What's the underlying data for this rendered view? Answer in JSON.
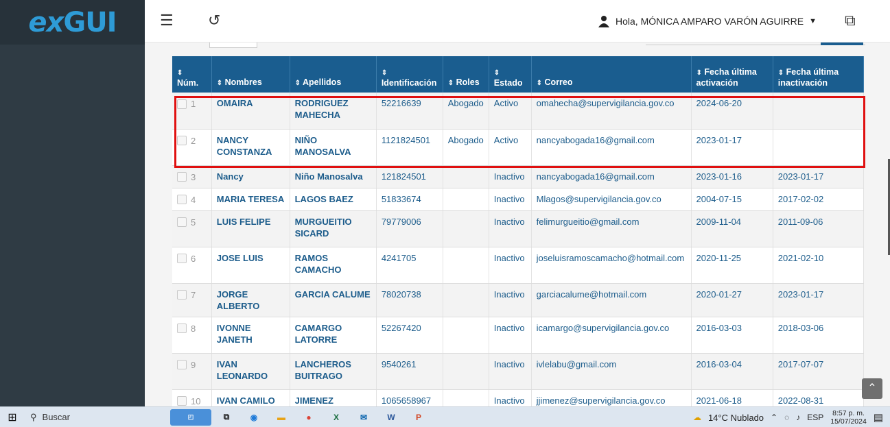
{
  "logo": {
    "prefix": "ex",
    "suffix": "GUI"
  },
  "topbar": {
    "menu_icon": "☰",
    "history_icon": "↺",
    "user_greeting": "Hola, MÓNICA AMPARO VARÓN AGUIRRE",
    "external_icon": "⧉"
  },
  "table": {
    "headers": [
      "Núm.",
      "Nombres",
      "Apellidos",
      "Identificación",
      "Roles",
      "Estado",
      "Correo",
      "Fecha última activación",
      "Fecha última inactivación"
    ],
    "rows": [
      {
        "num": "1",
        "nombres": "OMAIRA",
        "apellidos": "RODRIGUEZ MAHECHA",
        "id": "52216639",
        "roles": "Abogado",
        "estado": "Activo",
        "correo": "omahecha@supervigilancia.gov.co",
        "activacion": "2024-06-20",
        "inactivacion": ""
      },
      {
        "num": "2",
        "nombres": "NANCY CONSTANZA",
        "apellidos": "NIÑO MANOSALVA",
        "id": "1121824501",
        "roles": "Abogado",
        "estado": "Activo",
        "correo": "nancyabogada16@gmail.com",
        "activacion": "2023-01-17",
        "inactivacion": ""
      },
      {
        "num": "3",
        "nombres": "Nancy",
        "apellidos": "Niño Manosalva",
        "id": "121824501",
        "roles": "",
        "estado": "Inactivo",
        "correo": "nancyabogada16@gmail.com",
        "activacion": "2023-01-16",
        "inactivacion": "2023-01-17"
      },
      {
        "num": "4",
        "nombres": "MARIA TERESA",
        "apellidos": "LAGOS BAEZ",
        "id": "51833674",
        "roles": "",
        "estado": "Inactivo",
        "correo": "Mlagos@supervigilancia.gov.co",
        "activacion": "2004-07-15",
        "inactivacion": "2017-02-02"
      },
      {
        "num": "5",
        "nombres": "LUIS FELIPE",
        "apellidos": "MURGUEITIO SICARD",
        "id": "79779006",
        "roles": "",
        "estado": "Inactivo",
        "correo": "felimurgueitio@gmail.com",
        "activacion": "2009-11-04",
        "inactivacion": "2011-09-06"
      },
      {
        "num": "6",
        "nombres": "JOSE LUIS",
        "apellidos": "RAMOS CAMACHO",
        "id": "4241705",
        "roles": "",
        "estado": "Inactivo",
        "correo": "joseluisramoscamacho@hotmail.com",
        "activacion": "2020-11-25",
        "inactivacion": "2021-02-10"
      },
      {
        "num": "7",
        "nombres": "JORGE ALBERTO",
        "apellidos": "GARCIA CALUME",
        "id": "78020738",
        "roles": "",
        "estado": "Inactivo",
        "correo": "garciacalume@hotmail.com",
        "activacion": "2020-01-27",
        "inactivacion": "2023-01-17"
      },
      {
        "num": "8",
        "nombres": "IVONNE JANETH",
        "apellidos": "CAMARGO LATORRE",
        "id": "52267420",
        "roles": "",
        "estado": "Inactivo",
        "correo": "icamargo@supervigilancia.gov.co",
        "activacion": "2016-03-03",
        "inactivacion": "2018-03-06"
      },
      {
        "num": "9",
        "nombres": "IVAN LEONARDO",
        "apellidos": "LANCHEROS BUITRAGO",
        "id": "9540261",
        "roles": "",
        "estado": "Inactivo",
        "correo": "ivlelabu@gmail.com",
        "activacion": "2016-03-04",
        "inactivacion": "2017-07-07"
      },
      {
        "num": "10",
        "nombres": "IVAN CAMILO",
        "apellidos": "JIMENEZ",
        "id": "1065658967",
        "roles": "",
        "estado": "Inactivo",
        "correo": "jjimenez@supervigilancia.gov.co",
        "activacion": "2021-06-18",
        "inactivacion": "2022-08-31"
      }
    ]
  },
  "taskbar": {
    "search_label": "Buscar",
    "weather": "14°C  Nublado",
    "language": "ESP",
    "time": "8:57 p. m.",
    "date": "15/07/2024"
  }
}
